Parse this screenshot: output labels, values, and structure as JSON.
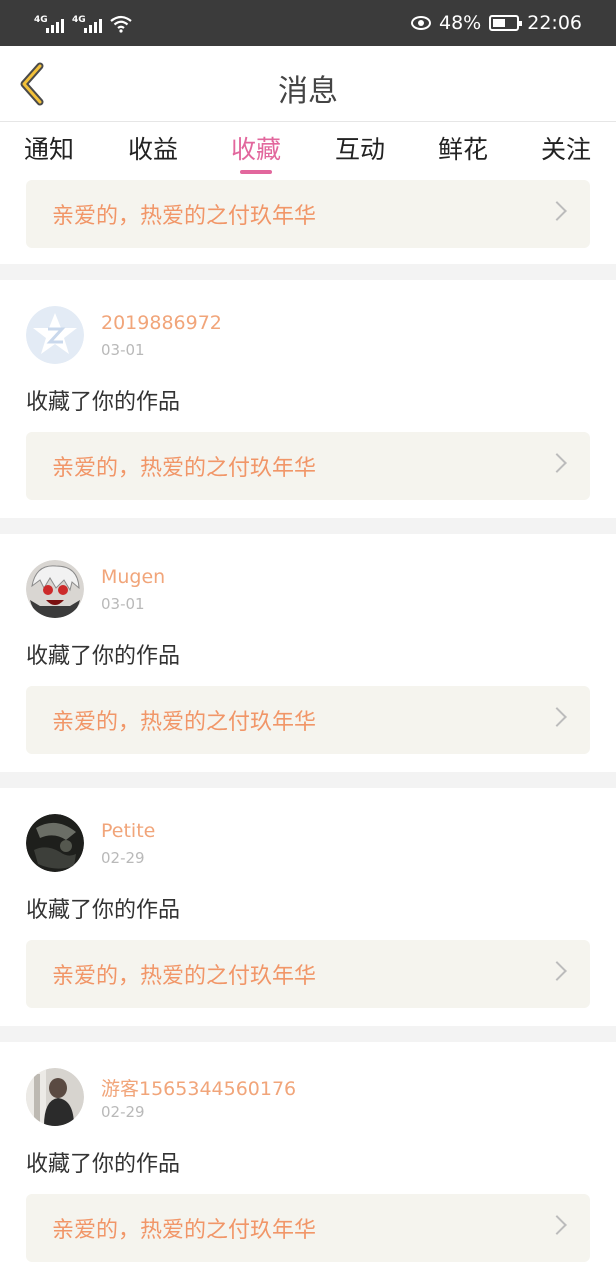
{
  "status_bar": {
    "battery": "48%",
    "time": "22:06",
    "net1": "4G",
    "net2": "4G"
  },
  "header": {
    "title": "消息"
  },
  "tabs": [
    {
      "label": "通知"
    },
    {
      "label": "收益"
    },
    {
      "label": "收藏",
      "active": true
    },
    {
      "label": "互动"
    },
    {
      "label": "鲜花"
    },
    {
      "label": "关注"
    }
  ],
  "top_partial": {
    "work_title": "亲爱的，热爱的之付玖年华"
  },
  "items": [
    {
      "username": "2019886972",
      "date": "03-01",
      "action": "收藏了你的作品",
      "work_title": "亲爱的，热爱的之付玖年华",
      "avatar": "qq-default-avatar"
    },
    {
      "username": "Mugen",
      "date": "03-01",
      "action": "收藏了你的作品",
      "work_title": "亲爱的，热爱的之付玖年华",
      "avatar": "anime-avatar"
    },
    {
      "username": "Petite",
      "date": "02-29",
      "action": "收藏了你的作品",
      "work_title": "亲爱的，热爱的之付玖年华",
      "avatar": "dark-photo-avatar"
    },
    {
      "username": "游客1565344560176",
      "date": "02-29",
      "action": "收藏了你的作品",
      "work_title": "亲爱的，热爱的之付玖年华",
      "avatar": "person-photo-avatar"
    }
  ],
  "colors": {
    "accent": "#e2679d",
    "username": "#f1a57a",
    "work_title": "#f19668",
    "back_arrow": "#f3c13a"
  }
}
